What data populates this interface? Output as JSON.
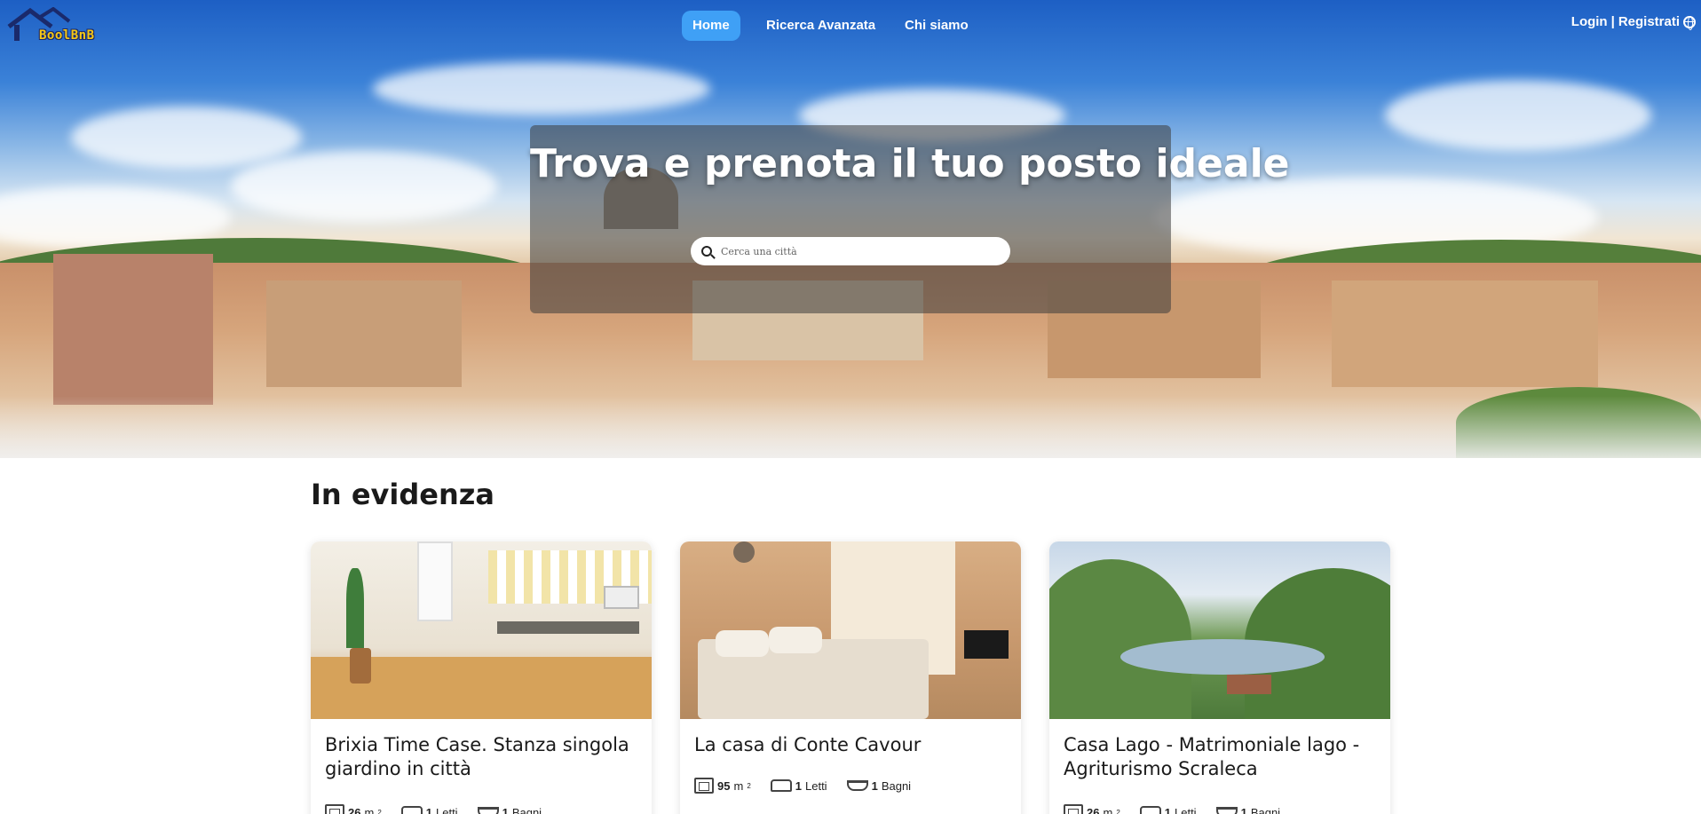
{
  "brand": {
    "logo_text": "BoolBnB"
  },
  "nav": {
    "items": [
      {
        "label": "Home",
        "active": true
      },
      {
        "label": "Ricerca Avanzata",
        "active": false
      },
      {
        "label": "Chi siamo",
        "active": false
      }
    ],
    "login": "Login",
    "separator": "|",
    "register": "Registrati",
    "globe_icon": "globe-icon"
  },
  "hero": {
    "title": "Trova e prenota il tuo posto ideale",
    "search_placeholder": "Cerca una città"
  },
  "featured": {
    "title": "In evidenza",
    "cards": [
      {
        "title": "Brixia Time Case. Stanza singola giardino in città",
        "area": "26",
        "area_unit": "m",
        "area_exp": "2",
        "beds": "1",
        "beds_label": "Letti",
        "baths": "1",
        "baths_label": "Bagni"
      },
      {
        "title": "La casa di Conte Cavour",
        "area": "95",
        "area_unit": "m",
        "area_exp": "2",
        "beds": "1",
        "beds_label": "Letti",
        "baths": "1",
        "baths_label": "Bagni"
      },
      {
        "title": "Casa Lago - Matrimoniale lago - Agriturismo Scraleca",
        "area": "26",
        "area_unit": "m",
        "area_exp": "2",
        "beds": "1",
        "beds_label": "Letti",
        "baths": "1",
        "baths_label": "Bagni"
      }
    ]
  },
  "colors": {
    "accent": "#3fa0f6",
    "logo_yellow": "#f7c815",
    "logo_navy": "#1a2a6b"
  }
}
